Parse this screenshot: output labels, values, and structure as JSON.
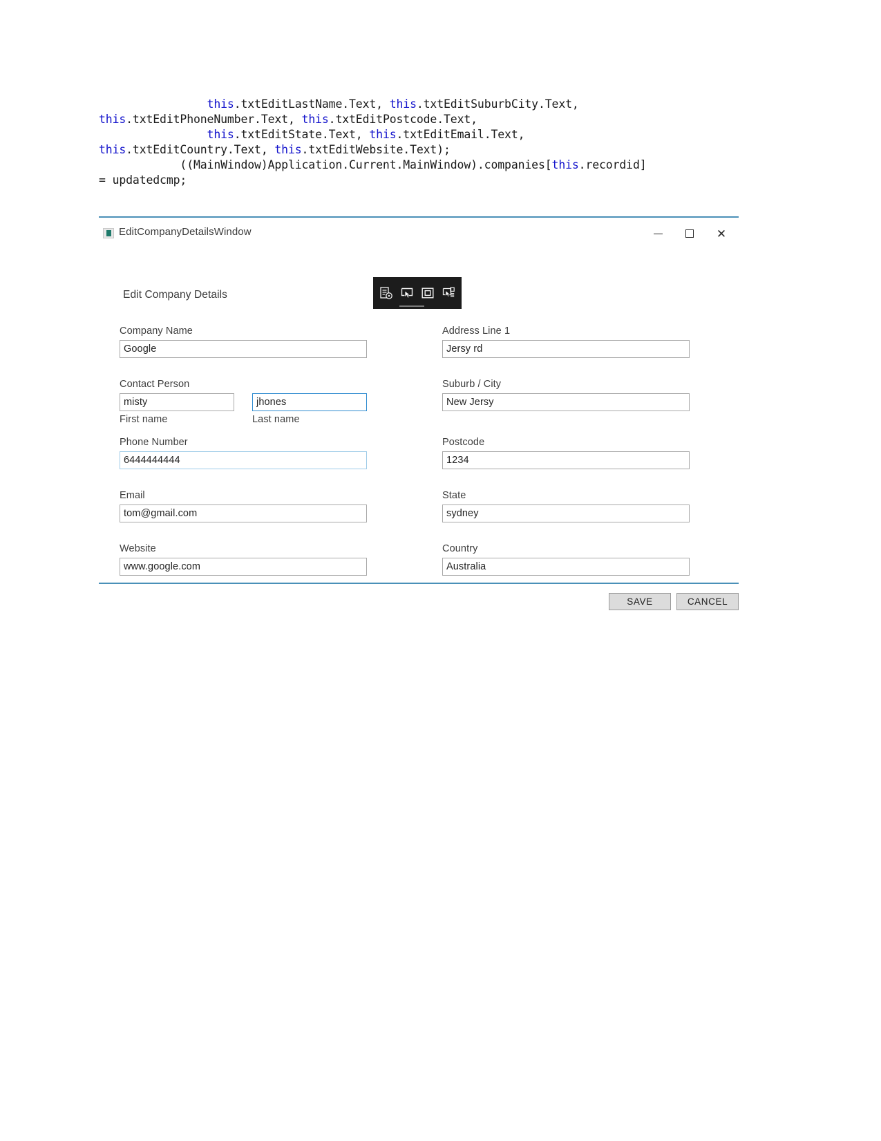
{
  "code_snippet": {
    "lines": [
      [
        {
          "t": "                ",
          "k": false
        },
        {
          "t": "this",
          "k": true
        },
        {
          "t": ".txtEditLastName.Text, ",
          "k": false
        },
        {
          "t": "this",
          "k": true
        },
        {
          "t": ".txtEditSuburbCity.Text,",
          "k": false
        }
      ],
      [
        {
          "t": "this",
          "k": true
        },
        {
          "t": ".txtEditPhoneNumber.Text, ",
          "k": false
        },
        {
          "t": "this",
          "k": true
        },
        {
          "t": ".txtEditPostcode.Text,",
          "k": false
        }
      ],
      [
        {
          "t": "                ",
          "k": false
        },
        {
          "t": "this",
          "k": true
        },
        {
          "t": ".txtEditState.Text, ",
          "k": false
        },
        {
          "t": "this",
          "k": true
        },
        {
          "t": ".txtEditEmail.Text,",
          "k": false
        }
      ],
      [
        {
          "t": "this",
          "k": true
        },
        {
          "t": ".txtEditCountry.Text, ",
          "k": false
        },
        {
          "t": "this",
          "k": true
        },
        {
          "t": ".txtEditWebsite.Text);",
          "k": false
        }
      ],
      [
        {
          "t": "            ((MainWindow)Application.Current.MainWindow).companies[",
          "k": false
        },
        {
          "t": "this",
          "k": true
        },
        {
          "t": ".recordid]",
          "k": false
        }
      ],
      [
        {
          "t": "= updatedcmp;",
          "k": false
        }
      ]
    ],
    "keyword_color": "#1414cc",
    "text_color": "#1a1a1a"
  },
  "window": {
    "title": "EditCompanyDetailsWindow",
    "icon": "app-window-icon",
    "controls": {
      "minimize": "minimize-icon",
      "maximize": "maximize-icon",
      "close_label": "✕"
    },
    "accent_color": "#4a90b8"
  },
  "toolbar": {
    "background": "#1c1c1c",
    "icons": [
      {
        "name": "element-properties-icon"
      },
      {
        "name": "select-element-icon"
      },
      {
        "name": "layout-frame-icon"
      },
      {
        "name": "go-to-live-visual-tree-icon"
      }
    ]
  },
  "form": {
    "heading": "Edit Company Details",
    "left_column": [
      {
        "name": "company-name",
        "label": "Company Name",
        "value": "Google",
        "state": "normal"
      },
      {
        "name": "contact-person",
        "label": "Contact Person",
        "first": {
          "name": "first-name",
          "value": "misty",
          "sublabel": "First name",
          "state": "normal"
        },
        "last": {
          "name": "last-name",
          "value": "jhones",
          "sublabel": "Last name",
          "state": "focused"
        }
      },
      {
        "name": "phone-number",
        "label": "Phone Number",
        "value": "6444444444",
        "state": "hovered"
      },
      {
        "name": "email",
        "label": "Email",
        "value": "tom@gmail.com",
        "state": "normal"
      },
      {
        "name": "website",
        "label": "Website",
        "value": "www.google.com",
        "state": "normal"
      }
    ],
    "right_column": [
      {
        "name": "address-line-1",
        "label": "Address Line 1",
        "value": "Jersy rd",
        "state": "normal"
      },
      {
        "name": "suburb-city",
        "label": "Suburb / City",
        "value": "New Jersy",
        "state": "normal"
      },
      {
        "name": "postcode",
        "label": "Postcode",
        "value": "1234",
        "state": "normal"
      },
      {
        "name": "state",
        "label": "State",
        "value": "sydney",
        "state": "normal"
      },
      {
        "name": "country",
        "label": "Country",
        "value": "Australia",
        "state": "normal"
      }
    ],
    "buttons": {
      "save": "SAVE",
      "cancel": "CANCEL"
    }
  }
}
